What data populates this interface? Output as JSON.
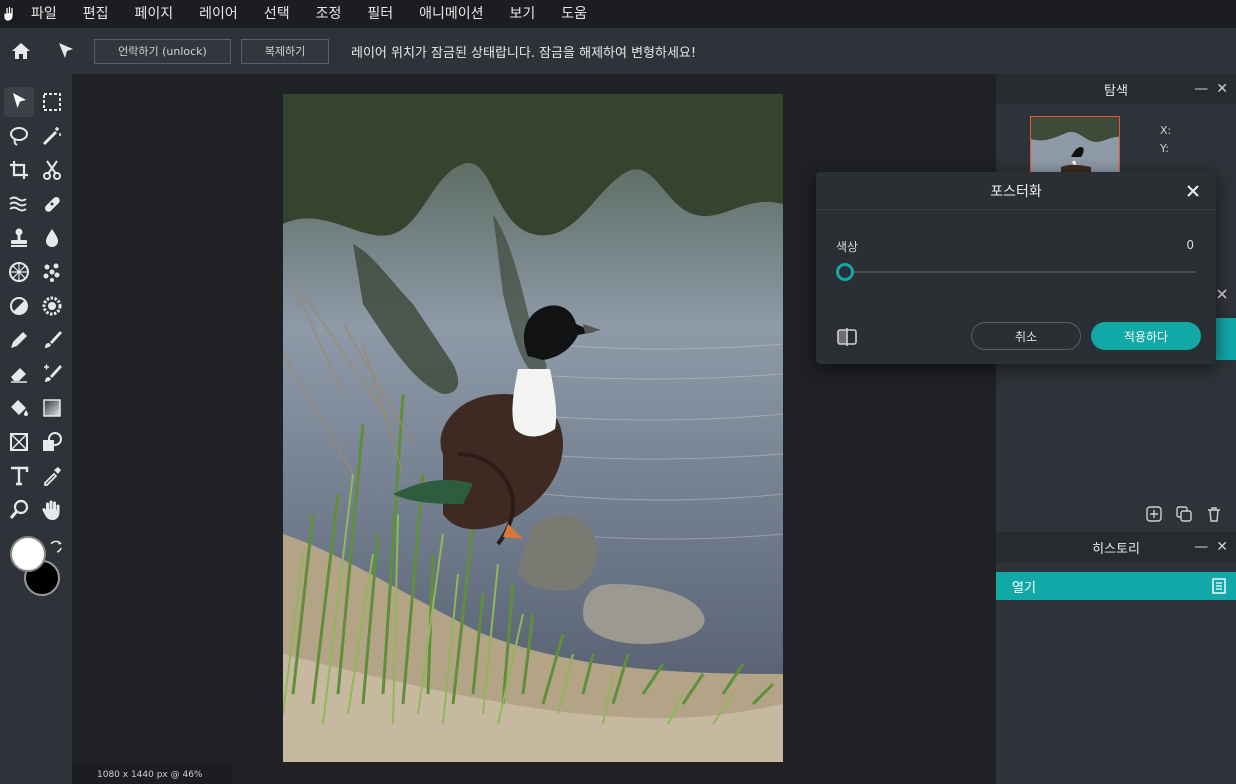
{
  "menubar": {
    "items": [
      "파일",
      "편집",
      "페이지",
      "레이어",
      "선택",
      "조정",
      "필터",
      "애니메이션",
      "보기",
      "도움"
    ]
  },
  "optionsbar": {
    "unlock_label": "언락하기 (unlock)",
    "duplicate_label": "복제하기",
    "message": "레이어 위치가 잠금된 상태랍니다. 잠금을 해제하여 변형하세요!"
  },
  "colors": {
    "accent": "#12a8a8",
    "foreground": "#ffffff",
    "background": "#000000"
  },
  "statusbar": {
    "info": "1080 x 1440 px @ 46%"
  },
  "panels": {
    "navigator": {
      "title": "탐색",
      "x_label": "X:",
      "y_label": "Y:"
    },
    "history": {
      "title": "히스토리",
      "items": [
        "열기"
      ]
    }
  },
  "dialog": {
    "title": "포스터화",
    "param_label": "색상",
    "param_value": "0",
    "slider_value": 0,
    "cancel_label": "취소",
    "apply_label": "적용하다"
  }
}
